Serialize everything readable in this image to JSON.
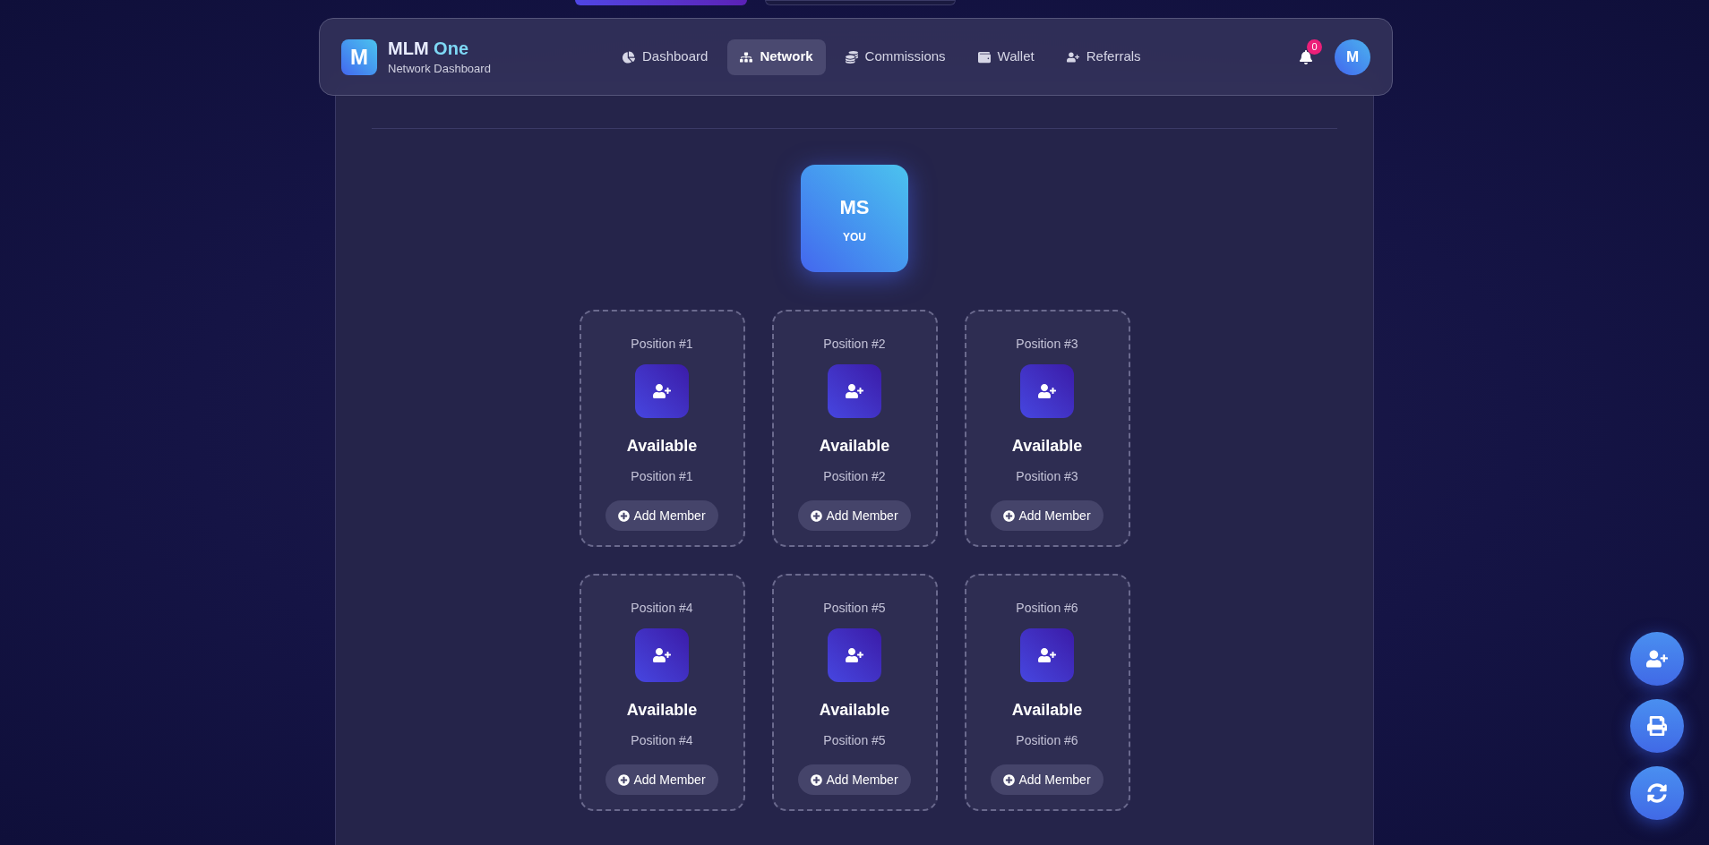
{
  "brand": {
    "logo": "M",
    "name": "MLM",
    "accent": "One",
    "subtitle": "Network Dashboard"
  },
  "nav": [
    {
      "label": "Dashboard",
      "selected": false
    },
    {
      "label": "Network",
      "selected": true
    },
    {
      "label": "Commissions",
      "selected": false
    },
    {
      "label": "Wallet",
      "selected": false
    },
    {
      "label": "Referrals",
      "selected": false
    }
  ],
  "notifications": {
    "count": "0"
  },
  "avatar": "M",
  "root": {
    "initials": "MS",
    "label": "YOU"
  },
  "positions": [
    {
      "title": "Position #1",
      "status": "Available",
      "subtitle": "Position #1",
      "action": "Add Member"
    },
    {
      "title": "Position #2",
      "status": "Available",
      "subtitle": "Position #2",
      "action": "Add Member"
    },
    {
      "title": "Position #3",
      "status": "Available",
      "subtitle": "Position #3",
      "action": "Add Member"
    },
    {
      "title": "Position #4",
      "status": "Available",
      "subtitle": "Position #4",
      "action": "Add Member"
    },
    {
      "title": "Position #5",
      "status": "Available",
      "subtitle": "Position #5",
      "action": "Add Member"
    },
    {
      "title": "Position #6",
      "status": "Available",
      "subtitle": "Position #6",
      "action": "Add Member"
    }
  ]
}
